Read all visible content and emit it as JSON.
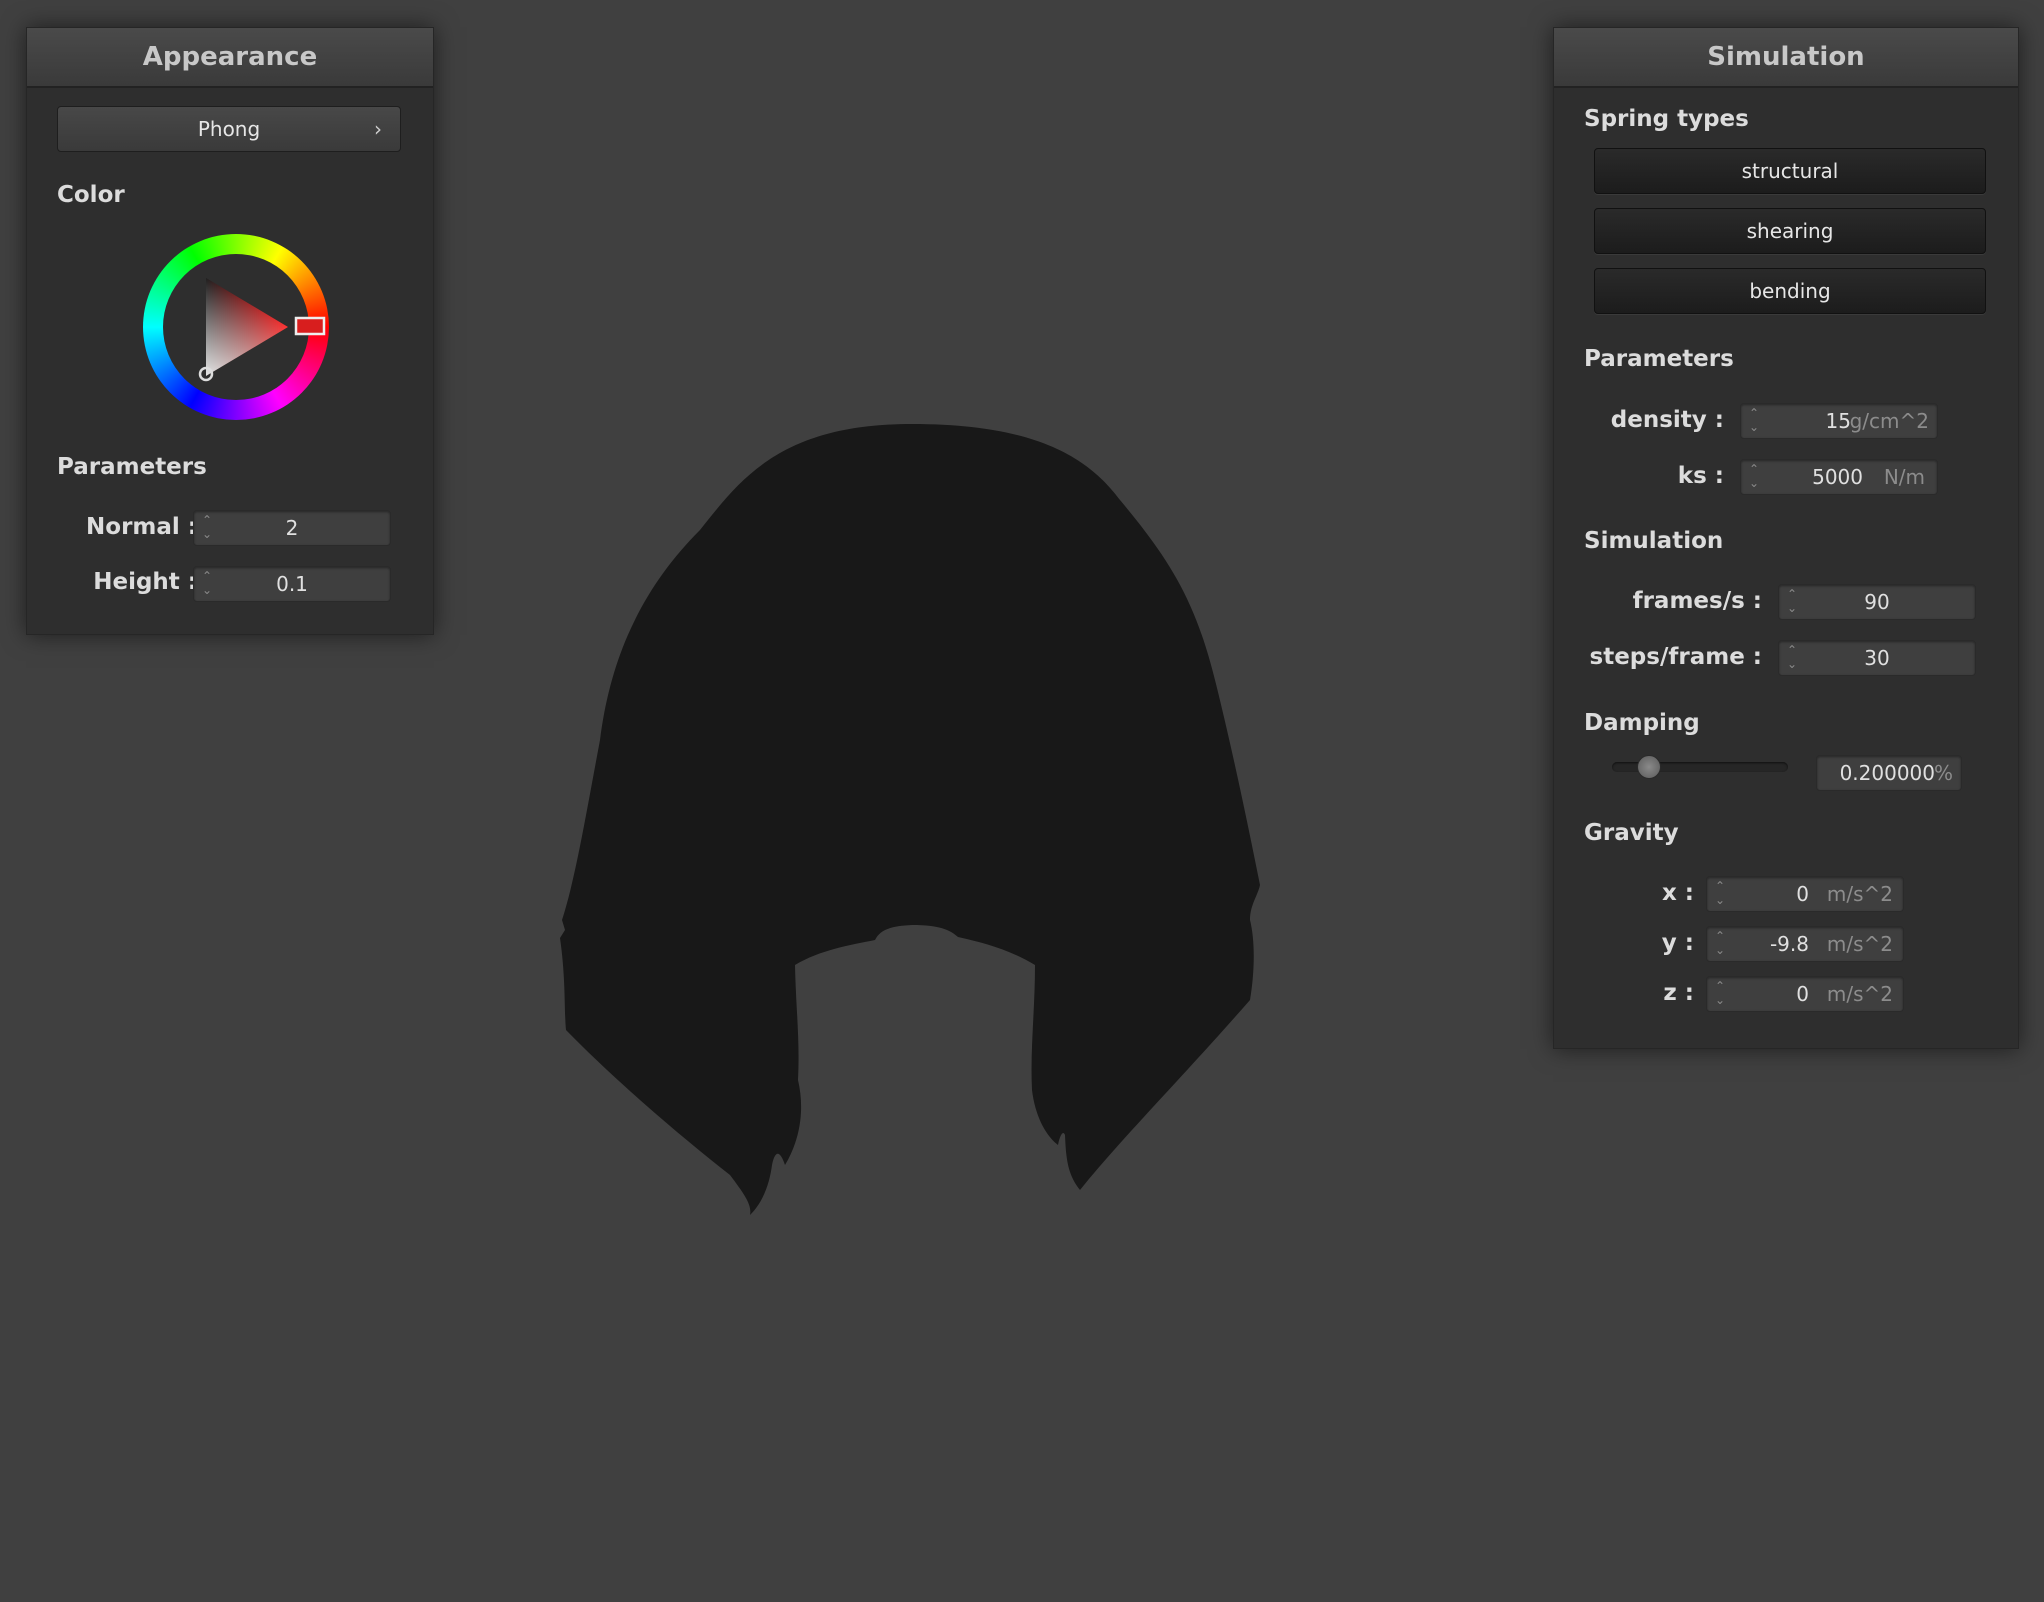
{
  "appearance": {
    "title": "Appearance",
    "shader_button": "Phong",
    "chevron": "›",
    "color_label": "Color",
    "selected_color": "#ff0000",
    "parameters_label": "Parameters",
    "normal_label": "Normal :",
    "normal_value": "2",
    "height_label": "Height :",
    "height_value": "0.1"
  },
  "simulation": {
    "title": "Simulation",
    "spring_types_label": "Spring types",
    "spring_buttons": [
      "structural",
      "shearing",
      "bending"
    ],
    "parameters_label": "Parameters",
    "density_label": "density :",
    "density_value": "15",
    "density_unit": "g/cm^2",
    "ks_label": "ks :",
    "ks_value": "5000",
    "ks_unit": "N/m",
    "simulation_label": "Simulation",
    "fps_label": "frames/s :",
    "fps_value": "90",
    "steps_label": "steps/frame :",
    "steps_value": "30",
    "damping_label": "Damping",
    "damping_value": "0.200000",
    "damping_unit": "%",
    "damping_level": 0.2,
    "gravity_label": "Gravity",
    "gx_label": "x :",
    "gx_value": "0",
    "gy_label": "y :",
    "gy_value": "-9.8",
    "gz_label": "z :",
    "gz_value": "0",
    "gravity_unit": "m/s^2"
  },
  "scene": {
    "background_color": "#404040",
    "cloth_color": "#1a1a1a"
  }
}
